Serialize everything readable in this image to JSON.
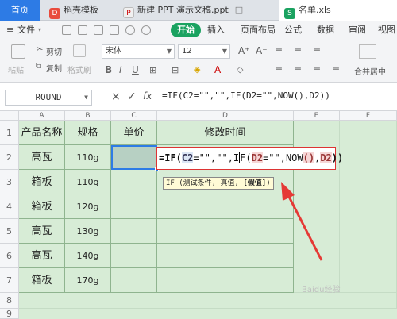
{
  "tabs": [
    {
      "label": "首页"
    },
    {
      "label": "稻壳模板"
    },
    {
      "label": "新建 PPT 演示文稿.ppt"
    },
    {
      "label": "名单.xls"
    }
  ],
  "menu": {
    "file": "文件",
    "items": [
      "开始",
      "插入",
      "页面布局",
      "公式",
      "数据",
      "审阅",
      "视图"
    ]
  },
  "toolbar": {
    "cut": "剪切",
    "copy": "复制",
    "paste": "粘贴",
    "format_painter": "格式刷",
    "font_name": "宋体",
    "font_size": "12",
    "merge_center": "合并居中"
  },
  "formula_bar": {
    "name_box": "ROUND",
    "cancel": "×",
    "confirm": "✓",
    "fx": "fx",
    "formula": "=IF(C2=\"\",\"\",IF(D2=\"\",NOW(),D2))"
  },
  "sheet": {
    "col_headers": [
      "A",
      "B",
      "C",
      "D",
      "E",
      "F"
    ],
    "row_headers": [
      "1",
      "2",
      "3",
      "4",
      "5",
      "6",
      "7",
      "8",
      "9"
    ],
    "header_row": [
      "产品名称",
      "规格",
      "单价",
      "修改时间"
    ],
    "rows": [
      [
        "高瓦",
        "110g"
      ],
      [
        "箱板",
        "110g"
      ],
      [
        "箱板",
        "120g"
      ],
      [
        "高瓦",
        "130g"
      ],
      [
        "高瓦",
        "140g"
      ],
      [
        "箱板",
        "170g"
      ]
    ],
    "active_cell": "C2"
  },
  "edit": {
    "p1": "=IF(",
    "r1": "C2",
    "p2": "=\"\",\"\",I",
    "p3": "F(",
    "r2": "D2",
    "p4": "=\"\",NOW",
    "p5": "()",
    "p6": ",",
    "r3": "D2",
    "p7": "))"
  },
  "tooltip": {
    "prefix": "IF (测试条件, 真值, ",
    "bold": "[假值]",
    "suffix": ")"
  },
  "watermark": "Baidu经验",
  "colors": {
    "accent": "#2d7be5",
    "start_button": "#1aa260",
    "sheet_bg": "#d7ecd6",
    "arrow": "#e53935"
  }
}
